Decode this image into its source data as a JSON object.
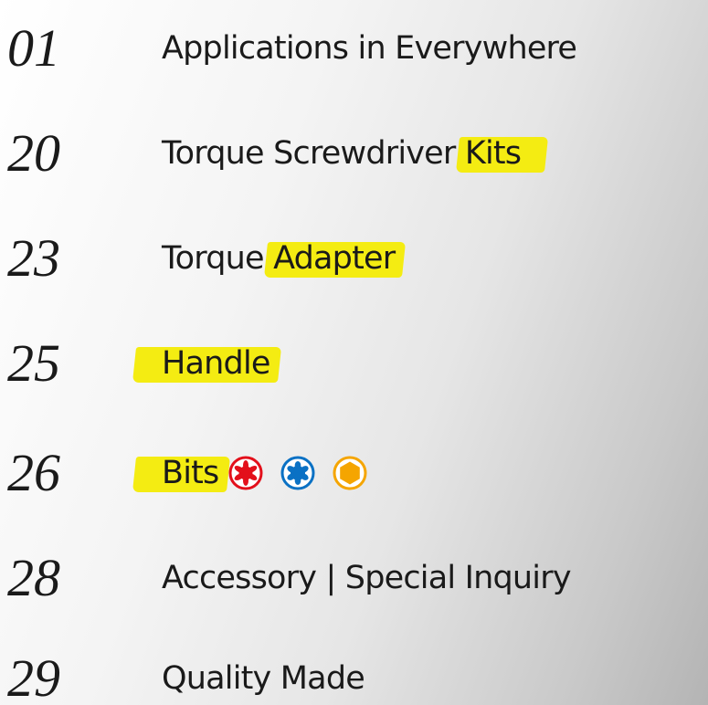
{
  "toc": [
    {
      "number": "01",
      "title": "Applications in Everywhere"
    },
    {
      "number": "20",
      "title_plain": "Torque Screwdriver ",
      "title_highlight": "Kits"
    },
    {
      "number": "23",
      "title_plain": "Torque ",
      "title_highlight": "Adapter"
    },
    {
      "number": "25",
      "title_highlight": "Handle"
    },
    {
      "number": "26",
      "title_highlight": "Bits",
      "icons": [
        "torx-red-icon",
        "torx-blue-icon",
        "hex-orange-icon"
      ]
    },
    {
      "number": "28",
      "title": "Accessory | Special Inquiry"
    },
    {
      "number": "29",
      "title": "Quality Made"
    }
  ],
  "colors": {
    "highlight": "#f4ec12",
    "red": "#e3101b",
    "blue": "#0a71c4",
    "orange": "#f5a500",
    "text": "#1a1a1a"
  }
}
